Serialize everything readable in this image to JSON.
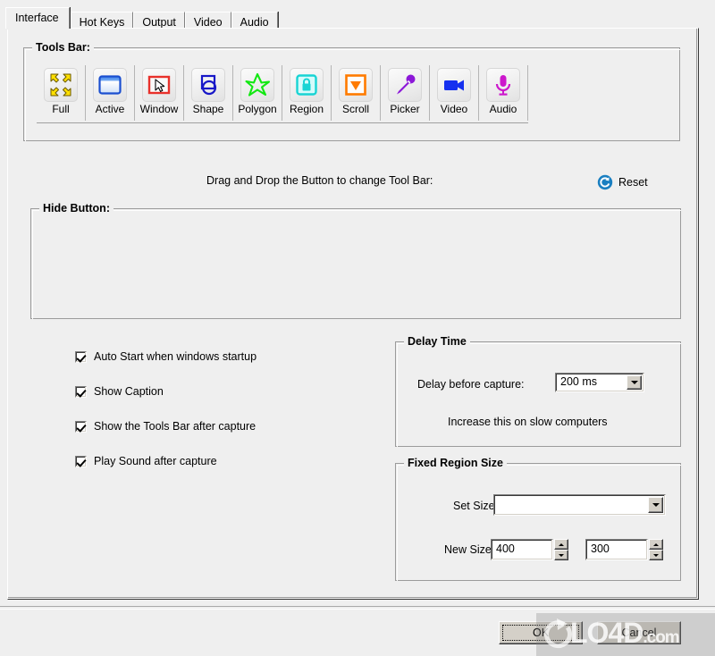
{
  "tabs": [
    {
      "label": "Interface",
      "selected": true
    },
    {
      "label": "Hot Keys",
      "selected": false
    },
    {
      "label": "Output",
      "selected": false
    },
    {
      "label": "Video",
      "selected": false
    },
    {
      "label": "Audio",
      "selected": false
    }
  ],
  "tools_bar": {
    "title": "Tools Bar:",
    "buttons": [
      {
        "label": "Full",
        "icon": "four-arrows-icon",
        "color": "#ffe000"
      },
      {
        "label": "Active",
        "icon": "window-active-icon",
        "color": "#1b4fd0"
      },
      {
        "label": "Window",
        "icon": "window-cursor-icon",
        "color": "#e8312b"
      },
      {
        "label": "Shape",
        "icon": "shape-icon",
        "color": "#1818c8"
      },
      {
        "label": "Polygon",
        "icon": "star-icon",
        "color": "#12e812"
      },
      {
        "label": "Region",
        "icon": "lock-region-icon",
        "color": "#18d4d4"
      },
      {
        "label": "Scroll",
        "icon": "scroll-down-icon",
        "color": "#ff7b00"
      },
      {
        "label": "Picker",
        "icon": "eyedropper-icon",
        "color": "#8c18d8"
      },
      {
        "label": "Video",
        "icon": "video-camera-icon",
        "color": "#1530ef"
      },
      {
        "label": "Audio",
        "icon": "microphone-icon",
        "color": "#cc18cc"
      }
    ]
  },
  "drag_tip": "Drag and Drop the Button to change Tool Bar:",
  "reset": {
    "label": "Reset",
    "icon": "refresh-circle-icon",
    "color": "#1a7fc1"
  },
  "hide_button": {
    "title": "Hide Button:"
  },
  "options": [
    {
      "label": "Auto Start when windows startup",
      "checked": true
    },
    {
      "label": "Show Caption",
      "checked": true
    },
    {
      "label": "Show the Tools Bar after capture",
      "checked": true
    },
    {
      "label": "Play Sound after capture",
      "checked": true
    }
  ],
  "delay_time": {
    "title": "Delay Time",
    "label": "Delay before capture:",
    "value": "200 ms",
    "hint": "Increase this on slow computers"
  },
  "fixed_region": {
    "title": "Fixed Region Size",
    "set_size_label": "Set Size:",
    "set_size_value": "",
    "new_size_label": "New Size:",
    "width": "400",
    "height": "300"
  },
  "buttons": {
    "ok": "OK",
    "cancel": "Cancel"
  },
  "watermark": {
    "text": "LO4D",
    "suffix": ".com"
  }
}
